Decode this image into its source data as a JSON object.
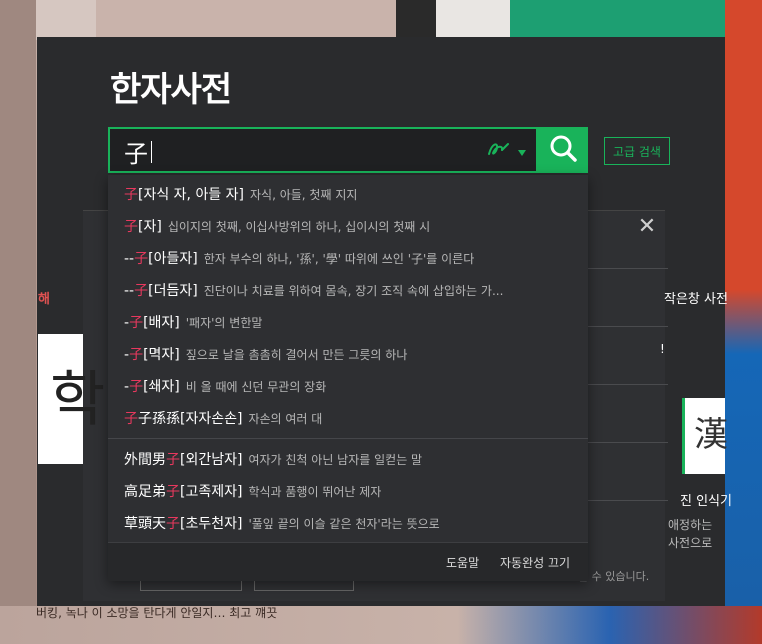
{
  "page": {
    "title": "한자사전",
    "search": {
      "value": "子",
      "placeholder": ""
    },
    "advanced_search_label": "고급 검색",
    "icons": {
      "handwrite": "handwriting-pen-icon",
      "dropdown_caret": "caret-down-icon",
      "search": "magnifier-icon",
      "close": "close-icon"
    },
    "colors": {
      "accent": "#19b35a",
      "hanja_highlight": "#e8385e",
      "panel_bg": "#2a2b2d"
    }
  },
  "autocomplete": {
    "items": [
      {
        "prefix": "",
        "hanja": "子",
        "suffix": "",
        "reading": "[자식 자, 아들 자]",
        "desc": "자식, 아들, 첫째 지지"
      },
      {
        "prefix": "",
        "hanja": "子",
        "suffix": "",
        "reading": "[자]",
        "desc": "십이지의 첫째, 이십사방위의 하나, 십이시의 첫째 시"
      },
      {
        "prefix": "--",
        "hanja": "子",
        "suffix": "",
        "reading": "[아들자]",
        "desc": "한자 부수의 하나, '孫', '學' 따위에 쓰인 '子'를 이른다"
      },
      {
        "prefix": "--",
        "hanja": "子",
        "suffix": "",
        "reading": "[더듬자]",
        "desc": "진단이나 치료를 위하여 몸속, 장기 조직 속에 삽입하는 가..."
      },
      {
        "prefix": "-",
        "hanja": "子",
        "suffix": "",
        "reading": "[배자]",
        "desc": "'패자'의 변한말"
      },
      {
        "prefix": "-",
        "hanja": "子",
        "suffix": "",
        "reading": "[멱자]",
        "desc": "짚으로 날을 촘촘히 결어서 만든 그릇의 하나"
      },
      {
        "prefix": "-",
        "hanja": "子",
        "suffix": "",
        "reading": "[쇄자]",
        "desc": "비 올 때에 신던 무관의 장화"
      },
      {
        "prefix": "",
        "hanja": "子",
        "suffix": "子孫孫",
        "reading": "[자자손손]",
        "desc": "자손의 여러 대"
      },
      {
        "prefix": "外間男",
        "hanja": "子",
        "suffix": "",
        "reading": "[외간남자]",
        "desc": "여자가 친척 아닌 남자를 일컫는 말"
      },
      {
        "prefix": "高足弟",
        "hanja": "子",
        "suffix": "",
        "reading": "[고족제자]",
        "desc": "학식과 품행이 뛰어난 제자"
      },
      {
        "prefix": "草頭天",
        "hanja": "子",
        "suffix": "",
        "reading": "[초두천자]",
        "desc": "'풀잎 끝의 이슬 같은 천자'라는 뜻으로"
      }
    ],
    "footer": {
      "help": "도움말",
      "turn_off": "자동완성 끄기"
    }
  },
  "background": {
    "left_tab": "해",
    "right_tab": "작은창 사전",
    "right_mark": "!",
    "right_line1": "진 인식기",
    "right_line2": "애정하는",
    "right_line3": "사전으로",
    "note": "할 수 있습니다.",
    "left_card_glyph": "학",
    "right_card_glyph": "漢",
    "bottom_text": "버킹, 녹나 이 소망을 탄다게 안일지… 최고 꺠끗"
  }
}
